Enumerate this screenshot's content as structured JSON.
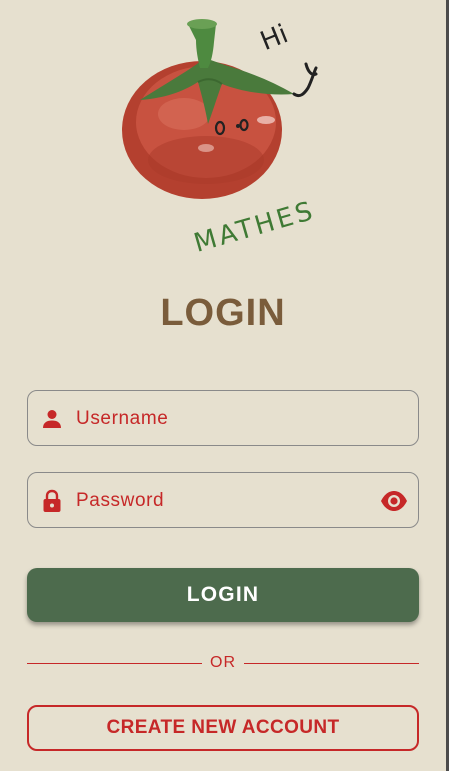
{
  "logo": {
    "greeting": "Hi",
    "wordmark": "MATHES",
    "icon": "tomato-icon"
  },
  "title": "LOGIN",
  "form": {
    "username": {
      "placeholder": "Username",
      "icon": "person-icon"
    },
    "password": {
      "placeholder": "Password",
      "icon": "lock-icon",
      "toggle_icon": "eye-icon"
    }
  },
  "login_button": "LOGIN",
  "divider_text": "OR",
  "create_account_button": "CREATE NEW ACCOUNT",
  "colors": {
    "background": "#e6e0cf",
    "title": "#7a5c3b",
    "accent_red": "#c62828",
    "button_green": "#4d6b4d"
  }
}
